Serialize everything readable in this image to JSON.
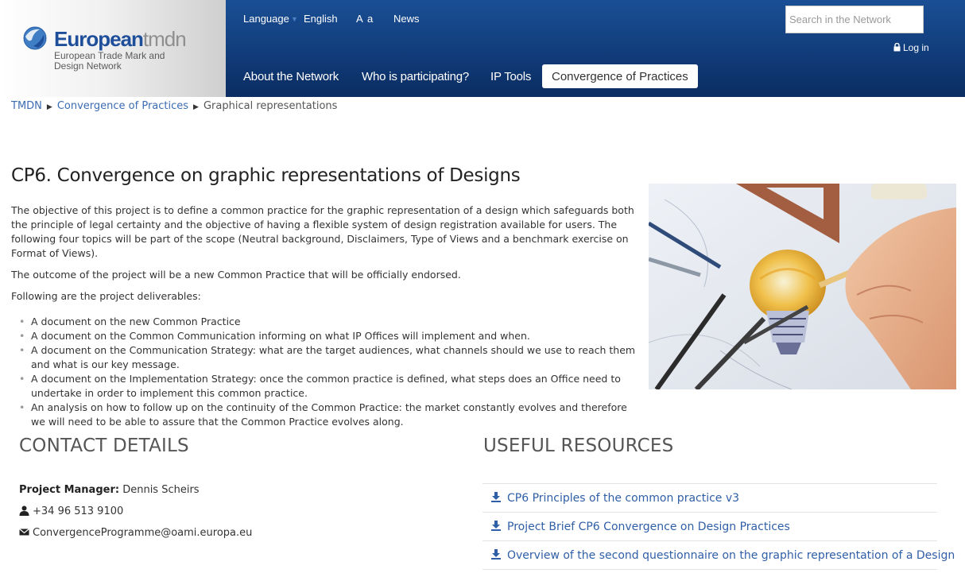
{
  "header": {
    "logo": {
      "name_bold": "European",
      "name_light": "tmdn",
      "subtitle": "European Trade Mark and Design Network"
    },
    "top_links": {
      "language_label": "Language",
      "language_value": "English",
      "font_size_large": "A",
      "font_size_small": "a",
      "news": "News"
    },
    "search": {
      "placeholder": "Search in the Network"
    },
    "login": "Log in",
    "main_nav": [
      {
        "label": "About the Network"
      },
      {
        "label": "Who is participating?"
      },
      {
        "label": "IP Tools"
      },
      {
        "label": "Convergence of Practices",
        "active": true
      }
    ],
    "colors": {
      "nav_blue": "#113c7a",
      "link_blue": "#3b6cb3"
    }
  },
  "breadcrumb": {
    "root": "TMDN",
    "parent": "Convergence of Practices",
    "current": "Graphical representations"
  },
  "article": {
    "title": "CP6. Convergence on graphic representations of Designs",
    "paragraphs": [
      "The objective of this project is to define a common practice for the graphic representation of a design which safeguards both the principle of legal certainty and the objective of having a flexible system of design registration available for users. The following four topics will be part of the scope (Neutral background, Disclaimers, Type of Views and a benchmark exercise on Format of Views).",
      "The outcome of the project will be a new Common Practice that will be officially endorsed.",
      "Following are the project deliverables:"
    ],
    "deliverables": [
      "A document on the new Common Practice",
      "A document on the Common Communication informing on what  IP Offices will implement and when.",
      "A document on the Communication Strategy: what are the target audiences, what channels should we use to reach them and what is our key message.",
      "A document on the Implementation Strategy: once the common practice is defined, what steps does an Office need to undertake in order to implement this common practice.",
      "An analysis on how to follow up on the continuity of the Common Practice: the market constantly evolves and therefore we will need to be able to assure that the Common Practice evolves along."
    ]
  },
  "contact": {
    "title": "CONTACT DETAILS",
    "manager_label": "Project Manager:",
    "manager_name": "Dennis Scheirs",
    "phone": "+34 96 513 9100",
    "email": "ConvergenceProgramme@oami.europa.eu"
  },
  "resources": {
    "title": "USEFUL RESOURCES",
    "items": [
      "CP6 Principles of the common practice v3",
      "Project Brief CP6 Convergence on Design Practices",
      "Overview of the second questionnaire on the graphic representation of a Design"
    ]
  }
}
